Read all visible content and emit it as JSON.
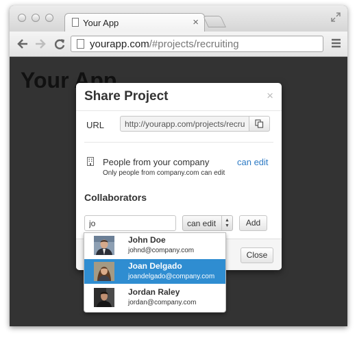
{
  "browser": {
    "tab_title": "Your App",
    "tab_close": "×",
    "url_host": "yourapp.com",
    "url_path": "/#projects/recruiting"
  },
  "page": {
    "title": "Your App"
  },
  "modal": {
    "title": "Share Project",
    "close_x": "×",
    "url_label": "URL",
    "url_value": "http://yourapp.com/projects/recruiting",
    "company": {
      "title": "People from your company",
      "subtitle": "Only people from company.com can edit",
      "permission_link": "can edit"
    },
    "collaborators_heading": "Collaborators",
    "collab_input_value": "jo",
    "permission_select_value": "can edit",
    "add_label": "Add",
    "close_label": "Close"
  },
  "suggestions": [
    {
      "name": "John Doe",
      "email": "johnd@company.com",
      "highlighted": false
    },
    {
      "name": "Joan Delgado",
      "email": "joandelgado@company.com",
      "highlighted": true
    },
    {
      "name": "Jordan Raley",
      "email": "jordan@company.com",
      "highlighted": false
    }
  ],
  "colors": {
    "accent": "#2f8dd1",
    "link": "#2d7ac4",
    "page_background": "#333333"
  }
}
